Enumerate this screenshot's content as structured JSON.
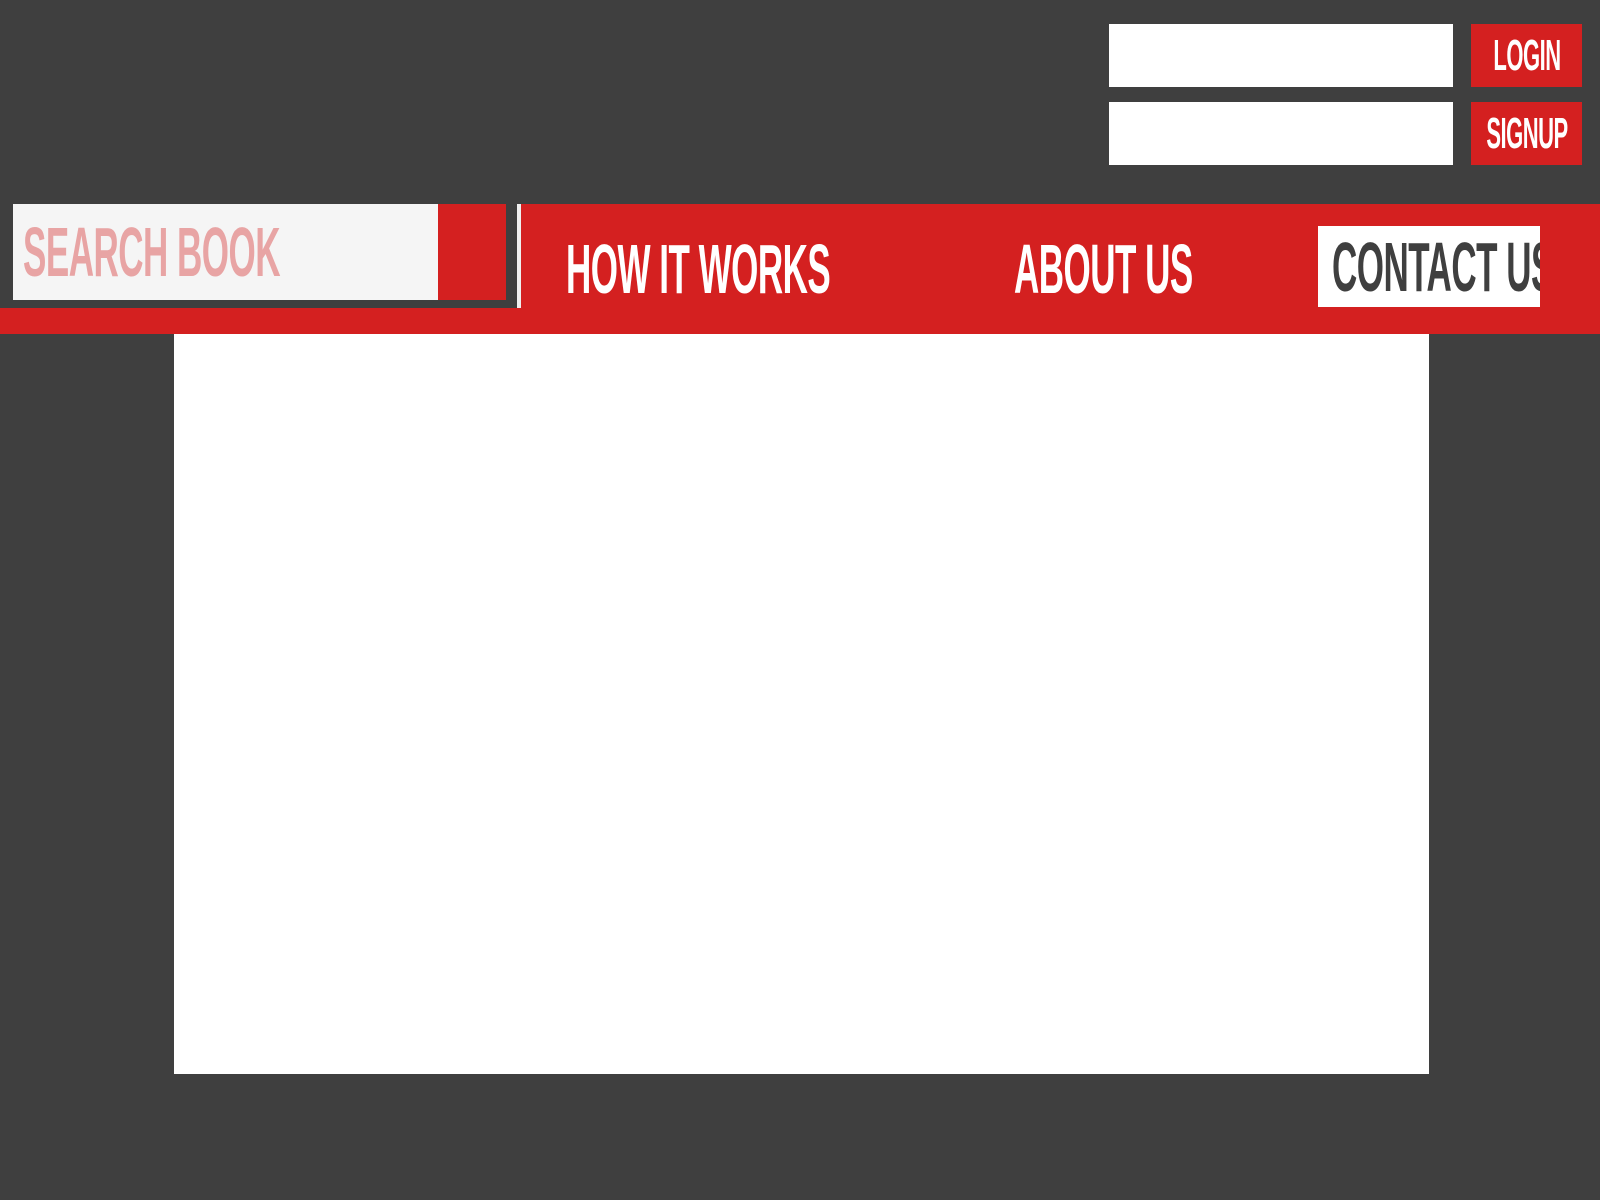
{
  "auth": {
    "login_label": "LOGIN",
    "signup_label": "SIGNUP",
    "username_value": "",
    "password_value": ""
  },
  "nav": {
    "search_placeholder": "SEARCH BOOK",
    "links": [
      {
        "label": "HOW IT WORKS"
      },
      {
        "label": "ABOUT US"
      },
      {
        "label": "CONTACT US",
        "active": true
      }
    ]
  },
  "colors": {
    "background": "#3f3f3f",
    "accent": "#d42020",
    "panel": "#ffffff",
    "search_text": "#e8a4a4",
    "search_field": "#f5f5f5"
  },
  "icons": {
    "search_button": "search-icon"
  }
}
